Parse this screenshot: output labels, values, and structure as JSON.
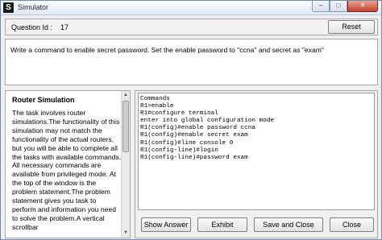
{
  "window": {
    "title": "Simulator",
    "icon_letter": "S",
    "minimize_glyph": "–",
    "maximize_glyph": "□",
    "close_glyph": "✕"
  },
  "question": {
    "id_label": "Question Id :",
    "id_value": "17",
    "reset_label": "Reset",
    "text": "Write a command to enable secret password. Set the enable password to \"ccna\" and secret as \"exam\""
  },
  "left_panel": {
    "title": "Router Simulation",
    "body": "The task involves router simulations.The functionality of this simulation may not match the functionality of the actual routers, but you will be able to complete all the tasks with available commands. All necessary commands are available from privileged mode. At the top of the window is the problem statement.The problem statement gives you task to perform and information you need to solve the problem.A vertical scrollbar"
  },
  "console": {
    "lines": [
      "Commands",
      "R1>enable",
      "R1#configure terminal",
      "enter into global configuration mode",
      "R1(config)#enable password ccna",
      "R1(config)#enable secret exam",
      "R1(config)#line console 0",
      "R1(config-line)#login",
      "R1(config-line)#password exam"
    ]
  },
  "buttons": {
    "show_answer": "Show Answer",
    "exhibit": "Exhibit",
    "save_and_close": "Save and Close",
    "close": "Close"
  }
}
